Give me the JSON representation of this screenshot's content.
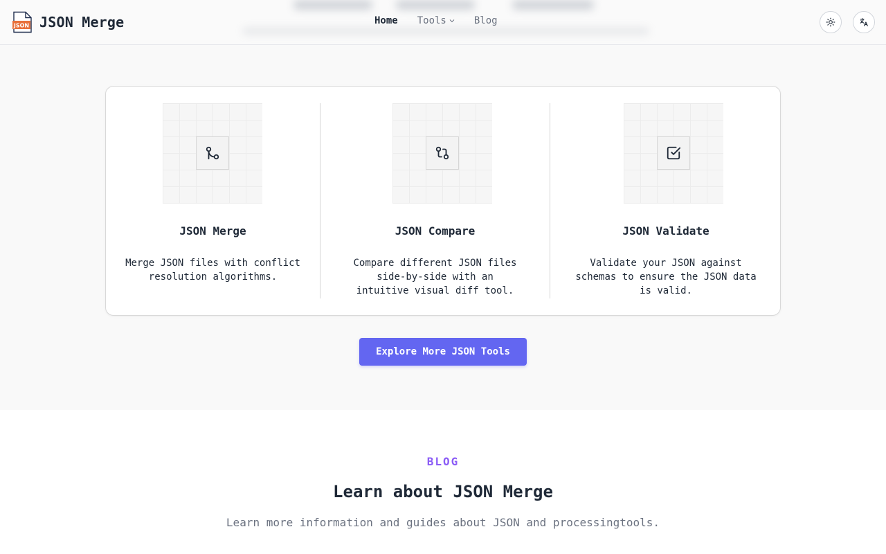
{
  "header": {
    "brand": {
      "name": "JSON Merge",
      "logo_text": "JSON",
      "logo_icon": "json-file-icon"
    },
    "nav": [
      {
        "label": "Home",
        "active": true
      },
      {
        "label": "Tools",
        "has_dropdown": true
      },
      {
        "label": "Blog"
      }
    ],
    "theme_toggle_icon": "sun-icon",
    "language_icon": "translate-icon"
  },
  "features": [
    {
      "icon": "git-merge-icon",
      "title": "JSON Merge",
      "description": "Merge JSON files with conflict resolution algorithms."
    },
    {
      "icon": "git-compare-icon",
      "title": "JSON Compare",
      "description": "Compare different JSON files side-by-side with an intuitive visual diff tool."
    },
    {
      "icon": "square-check-icon",
      "title": "JSON Validate",
      "description": "Validate your JSON against schemas to ensure the JSON data is valid."
    }
  ],
  "cta": {
    "label": "Explore More JSON Tools"
  },
  "blog": {
    "eyebrow": "BLOG",
    "title": "Learn about JSON Merge",
    "subtitle": "Learn more information and guides about JSON and processingtools."
  },
  "colors": {
    "accent": "#6366f1",
    "eyebrow": "#8b5cf6",
    "logo_orange": "#e8703a",
    "band_background": "#f9f9f9"
  }
}
